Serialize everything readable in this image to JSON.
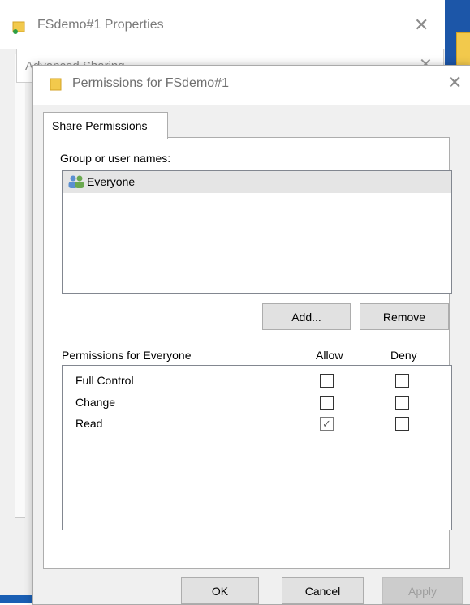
{
  "properties_window": {
    "title": "FSdemo#1 Properties",
    "close_glyph": "✕"
  },
  "advanced_sharing_window": {
    "title": "Advanced Sharing",
    "close_glyph": "✕"
  },
  "permissions_dialog": {
    "title": "Permissions for FSdemo#1",
    "close_glyph": "✕",
    "tab_label": "Share Permissions",
    "group_label": "Group or user names:",
    "users": [
      {
        "name": "Everyone",
        "icon": "users-icon",
        "selected": true
      }
    ],
    "add_button": "Add...",
    "remove_button": "Remove",
    "permissions_header": "Permissions for Everyone",
    "allow_header": "Allow",
    "deny_header": "Deny",
    "permissions": [
      {
        "name": "Full Control",
        "allow": false,
        "deny": false
      },
      {
        "name": "Change",
        "allow": false,
        "deny": false
      },
      {
        "name": "Read",
        "allow": true,
        "deny": false
      }
    ],
    "ok_button": "OK",
    "cancel_button": "Cancel",
    "apply_button": "Apply"
  },
  "icons": {
    "folder": "folder-icon",
    "close": "close-icon",
    "users": "users-icon"
  },
  "colors": {
    "dialog_bg": "#f0f0f0",
    "selected_row": "#e5e5e5",
    "desktop_accent": "#1c56a8",
    "folder_yellow": "#f2c94c"
  }
}
